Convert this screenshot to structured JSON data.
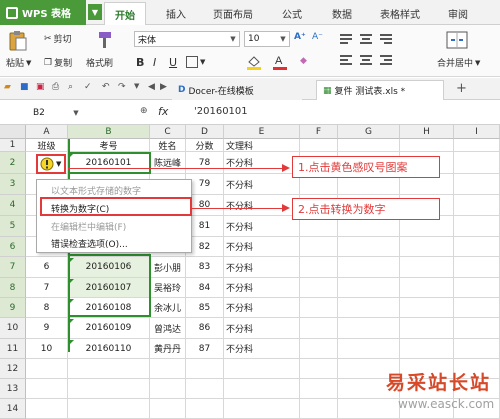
{
  "app": {
    "name": "WPS 表格"
  },
  "ribbon_tabs": [
    "开始",
    "插入",
    "页面布局",
    "公式",
    "数据",
    "表格样式",
    "审阅"
  ],
  "ribbon": {
    "paste": "粘贴",
    "cut": "剪切",
    "copy": "复制",
    "format_painter": "格式刷",
    "font_name": "宋体",
    "font_size": "10",
    "bold": "B",
    "italic": "I",
    "underline": "U",
    "merge_center": "合并居中"
  },
  "doc_tabs": [
    {
      "label": "Docer-在线模板"
    },
    {
      "label": "复件 测试表.xls *"
    }
  ],
  "formula_bar": {
    "name_box": "B2",
    "fx": "fx",
    "value": "'20160101"
  },
  "columns": [
    "A",
    "B",
    "C",
    "D",
    "E",
    "F",
    "G",
    "H",
    "I"
  ],
  "rows": [
    "1",
    "2",
    "3",
    "4",
    "5",
    "6",
    "7",
    "8",
    "9",
    "10",
    "11",
    "12",
    "13",
    "14",
    "15"
  ],
  "table": {
    "headers": [
      "班级",
      "考号",
      "姓名",
      "分数",
      "文理科"
    ],
    "data": [
      [
        "",
        "20160101",
        "陈远峰",
        "78",
        "不分科"
      ],
      [
        "",
        "",
        "",
        "79",
        "不分科"
      ],
      [
        "",
        "",
        "",
        "80",
        "不分科"
      ],
      [
        "",
        "",
        "",
        "81",
        "不分科"
      ],
      [
        "",
        "",
        "",
        "82",
        "不分科"
      ],
      [
        "6",
        "20160106",
        "彭小朋",
        "83",
        "不分科"
      ],
      [
        "7",
        "20160107",
        "吴裕玲",
        "84",
        "不分科"
      ],
      [
        "8",
        "20160108",
        "余冰儿",
        "85",
        "不分科"
      ],
      [
        "9",
        "20160109",
        "曾鸿达",
        "86",
        "不分科"
      ],
      [
        "10",
        "20160110",
        "黄丹丹",
        "87",
        "不分科"
      ]
    ]
  },
  "context_menu": {
    "items": [
      {
        "label": "以文本形式存储的数字",
        "enabled": false
      },
      {
        "label": "转换为数字(C)",
        "enabled": true
      },
      {
        "label": "在编辑栏中编辑(F)",
        "enabled": false
      },
      {
        "label": "错误检查选项(O)...",
        "enabled": true
      }
    ]
  },
  "annotations": {
    "step1": "1.点击黄色感叹号图案",
    "step2": "2.点击转换为数字"
  },
  "watermark": {
    "cn": "易采站长站",
    "url": "www.easck.com"
  },
  "colors": {
    "accent": "#4a9a3a",
    "annotation": "#e23a3a",
    "selected_fill": "#e7f1df"
  }
}
